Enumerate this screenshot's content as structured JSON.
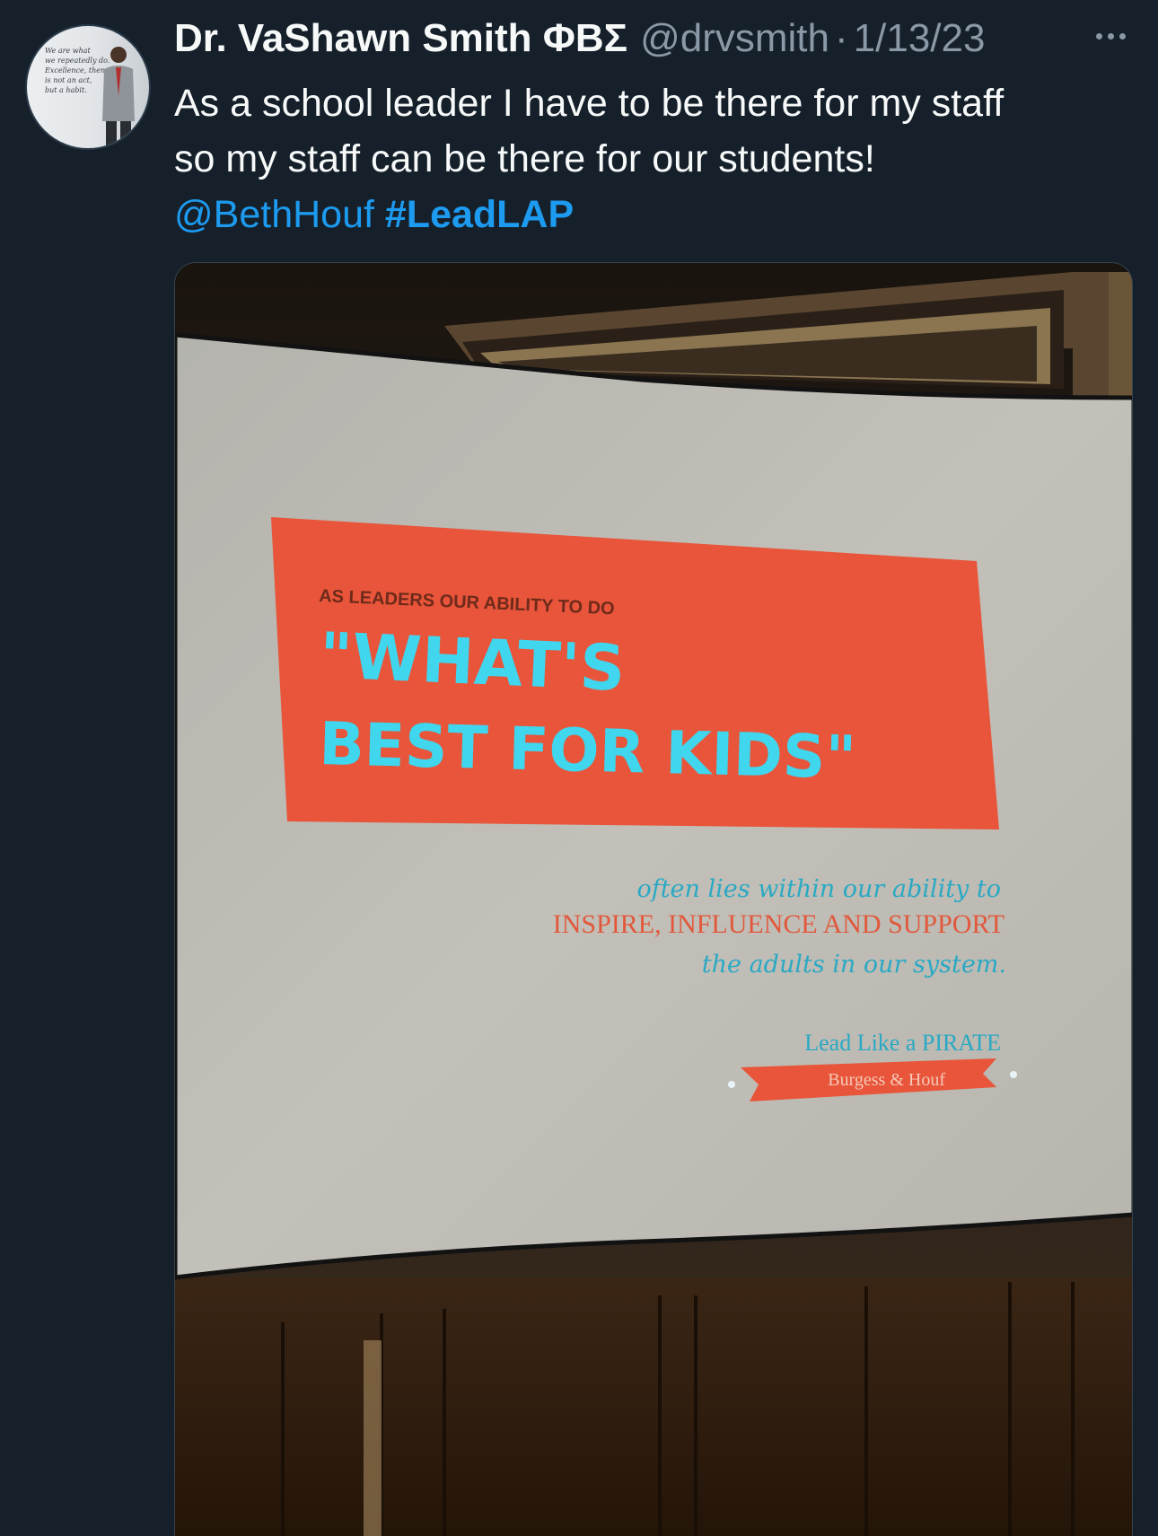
{
  "tweet": {
    "author_name": "Dr. VaShawn Smith ΦΒΣ",
    "handle": "@drvsmith",
    "separator": "·",
    "date": "1/13/23",
    "text_line1": "As a school leader I have to be there for my staff",
    "text_line2": "so my staff can be there for our students!",
    "mention": "@BethHouf",
    "hashtag": "#LeadLAP",
    "more_icon": "ellipsis-icon"
  },
  "avatar": {
    "quote_lines": [
      "We are what",
      "we repeatedly do.",
      "Excellence, then,",
      "is not an act,",
      "but a habit."
    ]
  },
  "slide": {
    "kicker": "AS LEADERS OUR ABILITY TO DO",
    "headline_line1": "\"WHAT'S",
    "headline_line2": "BEST FOR KIDS\"",
    "sub_line1": "often lies within our ability to",
    "sub_line2": "INSPIRE, INFLUENCE AND SUPPORT",
    "sub_line3": "the adults in our system.",
    "book_title": "Lead Like a PIRATE",
    "book_authors": "Burgess & Houf"
  },
  "colors": {
    "background": "#15202b",
    "link": "#1d9bf0",
    "secondary_text": "#8b98a5",
    "slide_orange": "#e8553a",
    "slide_cyan": "#3fd6ee",
    "screen": "#bdbbb3"
  }
}
